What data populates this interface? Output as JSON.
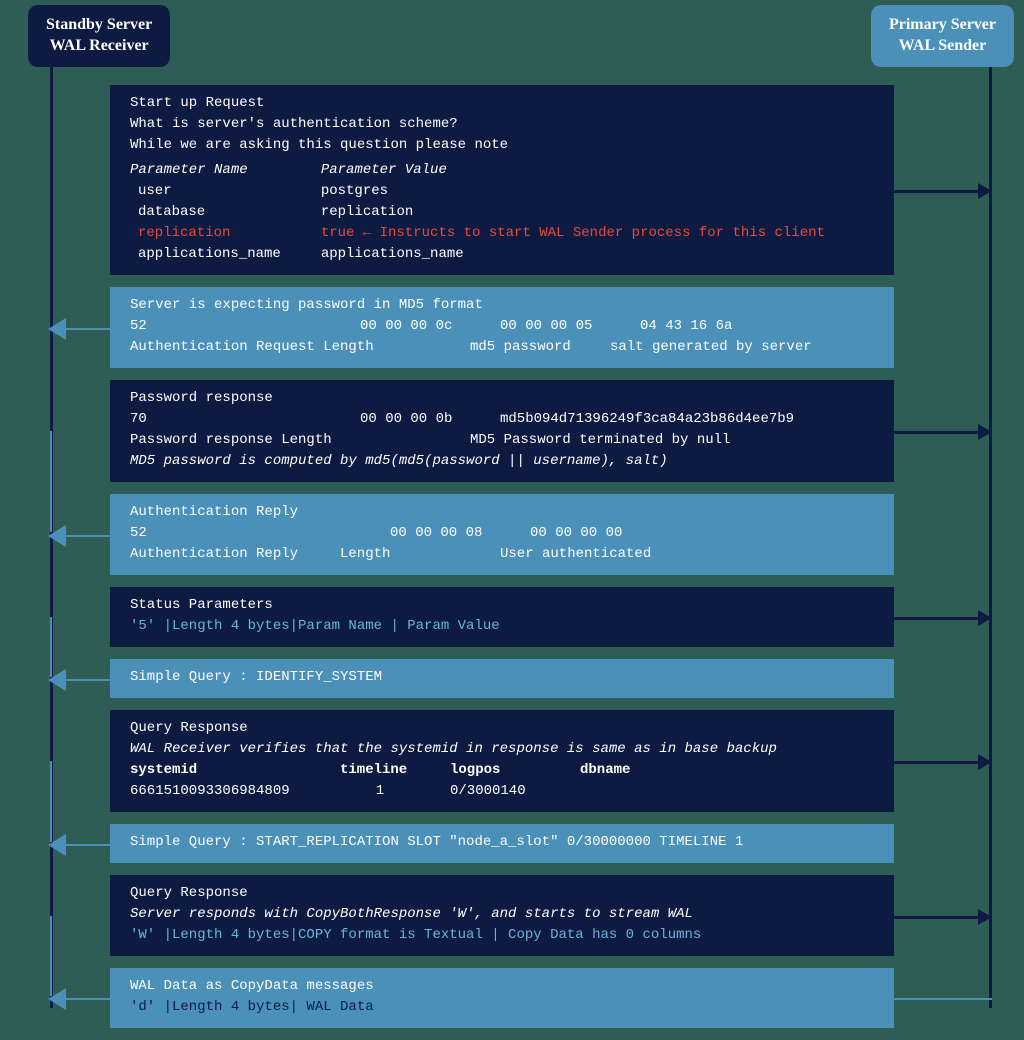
{
  "header": {
    "standby_line1": "Standby Server",
    "standby_line2": "WAL Receiver",
    "primary_line1": "Primary Server",
    "primary_line2": "WAL Sender"
  },
  "msg1": {
    "title": "Start up Request",
    "line2": "What is server's authentication scheme?",
    "line3": "While we are asking this question please note",
    "col_name": "Parameter Name",
    "col_value": "Parameter Value",
    "rows": [
      {
        "name": "user",
        "value": "postgres"
      },
      {
        "name": "database",
        "value": "replication"
      },
      {
        "name": "replication",
        "value": "true ← Instructs to start WAL Sender process for this client"
      },
      {
        "name": "applications_name",
        "value": "applications_name"
      }
    ]
  },
  "msg2": {
    "title": "Server is expecting password in MD5 format",
    "r1": {
      "c1": "52",
      "c2": "00 00 00 0c",
      "c3": "00 00 00 05",
      "c4": "04 43 16 6a"
    },
    "r2": {
      "c1": "Authentication Request Length",
      "c3": "md5 password",
      "c4": "salt generated by server"
    }
  },
  "msg3": {
    "title": "Password response",
    "r1": {
      "c1": "70",
      "c2": "00 00 00 0b",
      "c3": "md5b094d71396249f3ca84a23b86d4ee7b9"
    },
    "r2": {
      "c1": "Password response Length",
      "c3": "MD5 Password terminated by null"
    },
    "note": "MD5 password is computed by md5(md5(password || username), salt)"
  },
  "msg4": {
    "title": "Authentication Reply",
    "r1": {
      "c1": "52",
      "c2": "00 00 00 08",
      "c3": "00 00 00 00"
    },
    "r2": {
      "c1": "Authentication Reply",
      "c2": "Length",
      "c3": "User authenticated"
    }
  },
  "msg5": {
    "title": "Status Parameters",
    "detail": "'5' |Length 4 bytes|Param Name | Param Value"
  },
  "msg6": {
    "text": "Simple Query : IDENTIFY_SYSTEM"
  },
  "msg7": {
    "title": "Query Response",
    "note": "WAL Receiver verifies that the systemid in response is same as in base backup",
    "h": {
      "c1": "systemid",
      "c2": "timeline",
      "c3": "logpos",
      "c4": "dbname"
    },
    "d": {
      "c1": "6661510093306984809",
      "c2": "1",
      "c3": "0/3000140",
      "c4": ""
    }
  },
  "msg8": {
    "text": "Simple Query : START_REPLICATION SLOT \"node_a_slot\" 0/30000000 TIMELINE 1"
  },
  "msg9": {
    "title": "Query Response",
    "note": "Server responds with CopyBothResponse 'W', and starts to stream WAL",
    "detail": "'W' |Length 4 bytes|COPY format is Textual | Copy Data has 0 columns"
  },
  "msg10": {
    "title": "WAL Data as CopyData messages",
    "detail": "'d' |Length 4 bytes| WAL Data"
  }
}
